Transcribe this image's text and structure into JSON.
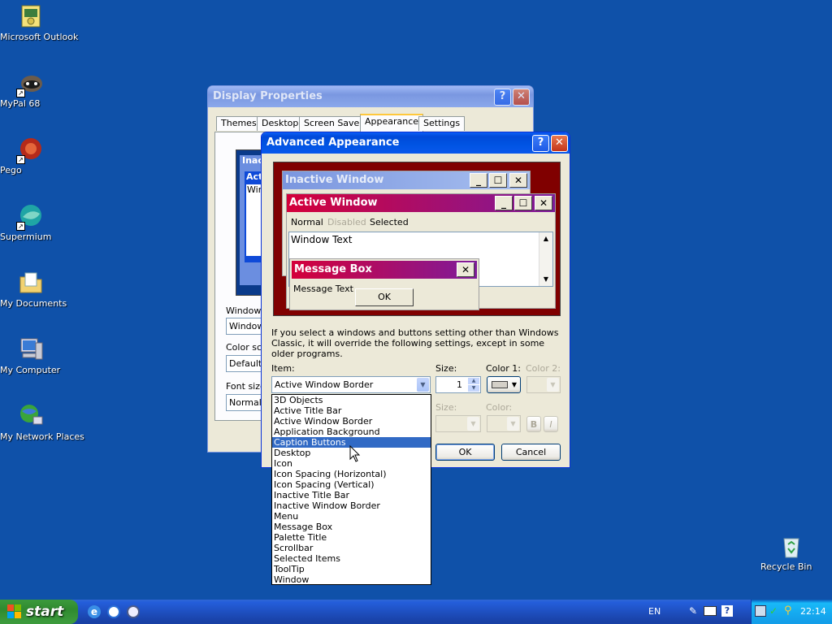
{
  "desktop": {
    "icons": [
      {
        "label": "Microsoft Outlook",
        "icon": "outlook-icon"
      },
      {
        "label": "MyPal 68",
        "icon": "mypal-icon"
      },
      {
        "label": "Pego",
        "icon": "pego-icon"
      },
      {
        "label": "Supermium",
        "icon": "supermium-icon"
      },
      {
        "label": "My Documents",
        "icon": "folder-icon"
      },
      {
        "label": "My Computer",
        "icon": "computer-icon"
      },
      {
        "label": "My Network Places",
        "icon": "network-icon"
      },
      {
        "label": "Recycle Bin",
        "icon": "recycle-bin-icon"
      }
    ]
  },
  "display_properties": {
    "title": "Display Properties",
    "help": "?",
    "close": "✕",
    "tabs": [
      "Themes",
      "Desktop",
      "Screen Saver",
      "Appearance",
      "Settings"
    ],
    "selected_tab": "Appearance",
    "labels": {
      "windows_buttons": "Windows",
      "windows_value": "Window",
      "color_scheme": "Color sch",
      "color_value": "Default",
      "font_size": "Font size",
      "font_value": "Normal"
    },
    "mini_preview": {
      "inactive": "Inac",
      "active": "Act",
      "text": "Win"
    }
  },
  "advanced_appearance": {
    "title": "Advanced Appearance",
    "help": "?",
    "close": "✕",
    "preview": {
      "inactive_title": "Inactive Window",
      "active_title": "Active Window",
      "menu_normal": "Normal",
      "menu_disabled": "Disabled",
      "menu_selected": "Selected",
      "window_text": "Window Text",
      "msgbox_title": "Message Box",
      "msgbox_text": "Message Text",
      "ok": "OK",
      "min": "_",
      "max": "☐",
      "close": "✕"
    },
    "info_text": "If you select a windows and buttons setting other than Windows Classic, it will override the following settings, except in some older programs.",
    "item_label": "Item:",
    "item_value": "Active Window Border",
    "size_label": "Size:",
    "size_value": "1",
    "color1_label": "Color 1:",
    "color2_label": "Color 2:",
    "font_size_label": "Size:",
    "font_color_label": "Color:",
    "bold": "B",
    "italic": "I",
    "ok": "OK",
    "cancel": "Cancel",
    "dropdown_items": [
      "3D Objects",
      "Active Title Bar",
      "Active Window Border",
      "Application Background",
      "Caption Buttons",
      "Desktop",
      "Icon",
      "Icon Spacing (Horizontal)",
      "Icon Spacing (Vertical)",
      "Inactive Title Bar",
      "Inactive Window Border",
      "Menu",
      "Message Box",
      "Palette Title",
      "Scrollbar",
      "Selected Items",
      "ToolTip",
      "Window"
    ],
    "highlighted_item": "Caption Buttons"
  },
  "taskbar": {
    "start": "start",
    "quick_launch": [
      "ie-icon",
      "browser-icon",
      "media-icon"
    ],
    "language": "EN",
    "clock": "22:14"
  },
  "colors": {
    "desktop": "#0f51a9",
    "preview_bg": "#800000",
    "selection": "#316ac5"
  }
}
